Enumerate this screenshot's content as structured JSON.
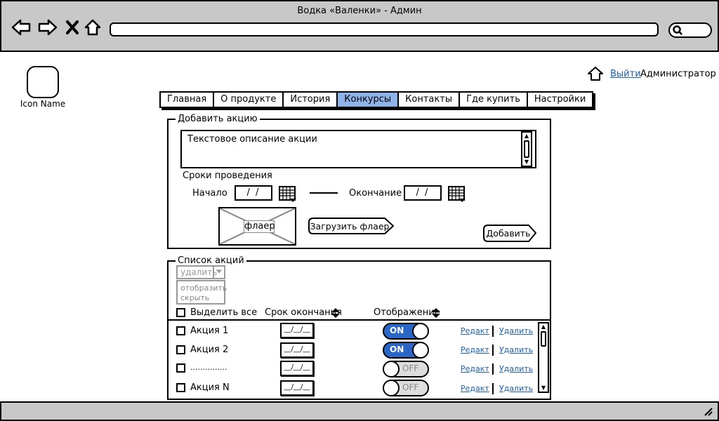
{
  "window": {
    "title": "Водка «Валенки» - Админ"
  },
  "logo": {
    "name": "Icon Name"
  },
  "user": {
    "logout": "Выйти",
    "role": "Администратор"
  },
  "tabs": [
    {
      "label": "Главная",
      "active": false
    },
    {
      "label": "О продукте",
      "active": false
    },
    {
      "label": "История",
      "active": false
    },
    {
      "label": "Конкурсы",
      "active": true
    },
    {
      "label": "Контакты",
      "active": false
    },
    {
      "label": "Где купить",
      "active": false
    },
    {
      "label": "Настройки",
      "active": false
    }
  ],
  "add_promo": {
    "legend": "Добавить акцию",
    "description": "Текстовое описание акции",
    "period_label": "Сроки проведения",
    "start_label": "Начало",
    "start_value": "/ /",
    "end_label": "Окончание",
    "end_value": "/ /",
    "flyer_label": "флаер",
    "upload_label": "Загрузить флаер",
    "add_label": "Добавить"
  },
  "promo_list": {
    "legend": "Список акций",
    "action_select": "удалить",
    "view_options": [
      "отобразить",
      "скрыть"
    ],
    "select_all": "Выделить все",
    "col_end": "Срок окончания",
    "col_display": "Отображение",
    "rows": [
      {
        "name": "Акция 1",
        "date": "__/__/__",
        "display": "ON",
        "on": true,
        "edit": "Редакт",
        "delete": "Удалить"
      },
      {
        "name": "Акция 2",
        "date": "__/__/__",
        "display": "ON",
        "on": true,
        "edit": "Редакт",
        "delete": "Удалить"
      },
      {
        "name": "...............",
        "date": "__/__/__",
        "display": "OFF",
        "on": false,
        "edit": "Редакт",
        "delete": "Удалить"
      },
      {
        "name": "Акция N",
        "date": "__/__/__",
        "display": "OFF",
        "on": false,
        "edit": "Редакт",
        "delete": "Удалить"
      }
    ]
  },
  "colors": {
    "accent": "#8fb3e8",
    "toggle_on": "#2a66c6",
    "link": "#1a5fb4",
    "chrome": "#c8c8c8"
  },
  "icons": [
    "back-arrow-icon",
    "forward-arrow-icon",
    "close-icon",
    "home-icon",
    "search-icon",
    "calendar-icon",
    "sort-icon",
    "resize-grip-icon"
  ]
}
